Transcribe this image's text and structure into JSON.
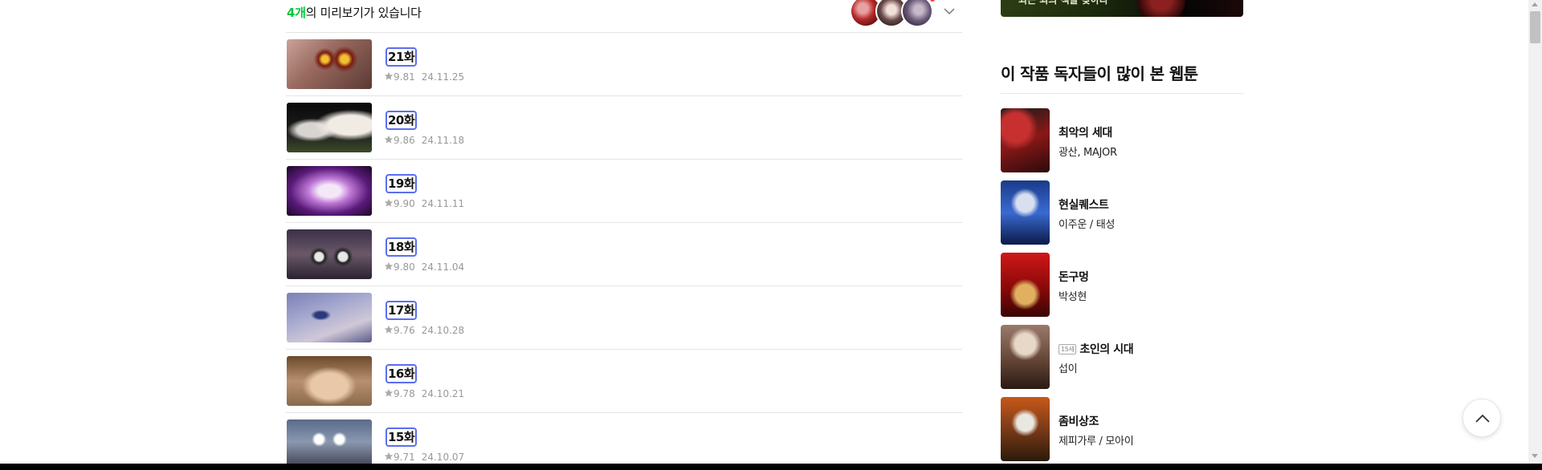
{
  "preview": {
    "count": "4개",
    "suffix": "의 미리보기가 있습니다"
  },
  "episodes": [
    {
      "title": "21화",
      "rating": "9.81",
      "date": "24.11.25"
    },
    {
      "title": "20화",
      "rating": "9.86",
      "date": "24.11.18"
    },
    {
      "title": "19화",
      "rating": "9.90",
      "date": "24.11.11"
    },
    {
      "title": "18화",
      "rating": "9.80",
      "date": "24.11.04"
    },
    {
      "title": "17화",
      "rating": "9.76",
      "date": "24.10.28"
    },
    {
      "title": "16화",
      "rating": "9.78",
      "date": "24.10.21"
    },
    {
      "title": "15화",
      "rating": "9.71",
      "date": "24.10.07"
    }
  ],
  "sidebar": {
    "promo_text": "최근 최의 책을 찾아라",
    "heading": "이 작품 독자들이 많이 본 웹툰",
    "recommendations": [
      {
        "title": "최악의 세대",
        "author": "광산, MAJOR",
        "age_badge": ""
      },
      {
        "title": "현실퀘스트",
        "author": "이주운 / 태성",
        "age_badge": ""
      },
      {
        "title": "돈구멍",
        "author": "박성현",
        "age_badge": ""
      },
      {
        "title": "초인의 시대",
        "author": "섭이",
        "age_badge": "15세"
      },
      {
        "title": "좀비상조",
        "author": "제피가루 / 모아이",
        "age_badge": ""
      }
    ]
  },
  "colors": {
    "accent_green": "#00c73c",
    "focus_outline": "#5b6ef0",
    "meta_gray": "#999999"
  },
  "icons": {
    "expand": "chevron-down-icon",
    "rating": "star-icon",
    "scroll_top": "arrow-up-icon"
  }
}
